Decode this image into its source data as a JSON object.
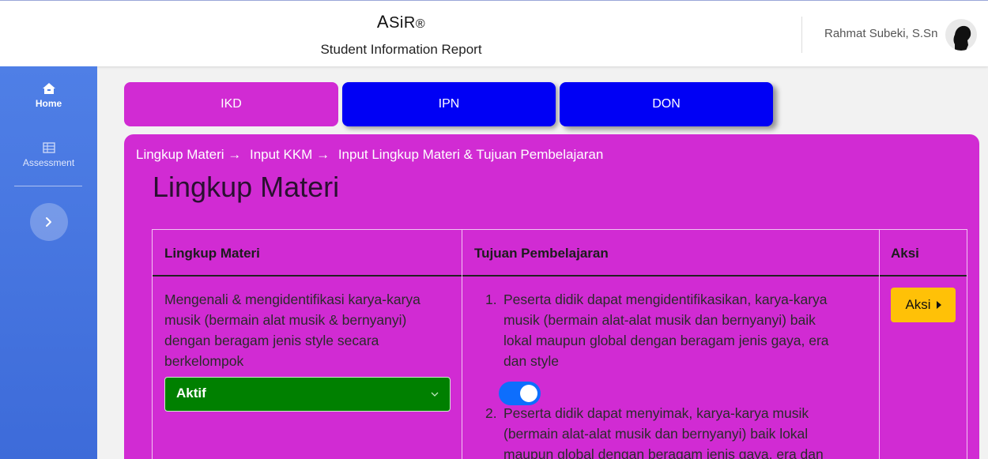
{
  "header": {
    "brand_a": "A",
    "brand_rest": "SiR",
    "brand_reg": "®",
    "subtitle": "Student Information Report",
    "user_name": "Rahmat Subeki, S.Sn"
  },
  "sidebar": {
    "items": [
      {
        "label": "Home",
        "icon": "home-icon"
      },
      {
        "label": "Assessment",
        "icon": "table-icon"
      }
    ],
    "toggle_icon": "chevron-right-icon"
  },
  "tabs": [
    {
      "label": "IKD"
    },
    {
      "label": "IPN"
    },
    {
      "label": "DON"
    }
  ],
  "breadcrumb": [
    "Lingkup Materi →",
    "Input KKM →",
    "Input Lingkup Materi & Tujuan Pembelajaran"
  ],
  "page_title": "Lingkup Materi",
  "table": {
    "headers": [
      "Lingkup Materi",
      "Tujuan Pembelajaran",
      "Aksi"
    ],
    "row": {
      "lingkup_lines": [
        "Mengenali & mengidentifikasi karya-karya",
        "musik (bermain alat musik & bernyanyi)",
        "dengan beragam jenis style secara",
        "berkelompok"
      ],
      "status_select": "Aktif",
      "tujuan": [
        {
          "num": "1.",
          "lines": [
            "Peserta didik dapat mengidentifikasikan, karya-karya",
            "musik (bermain alat-alat musik dan bernyanyi) baik",
            "lokal maupun global dengan beragam jenis gaya, era",
            "dan style"
          ]
        },
        {
          "num": "2.",
          "lines": [
            "Peserta didik dapat menyimak, karya-karya musik",
            "(bermain alat-alat musik dan bernyanyi) baik lokal",
            "maupun global dengan beragam jenis gaya, era dan"
          ]
        }
      ],
      "aksi_label": "Aksi"
    }
  },
  "colors": {
    "magenta": "#d12bd3",
    "blue_tab": "#0000f5",
    "select_green": "#008000",
    "toggle_blue": "#0d6efd",
    "aksi_yellow": "#ffc107"
  }
}
